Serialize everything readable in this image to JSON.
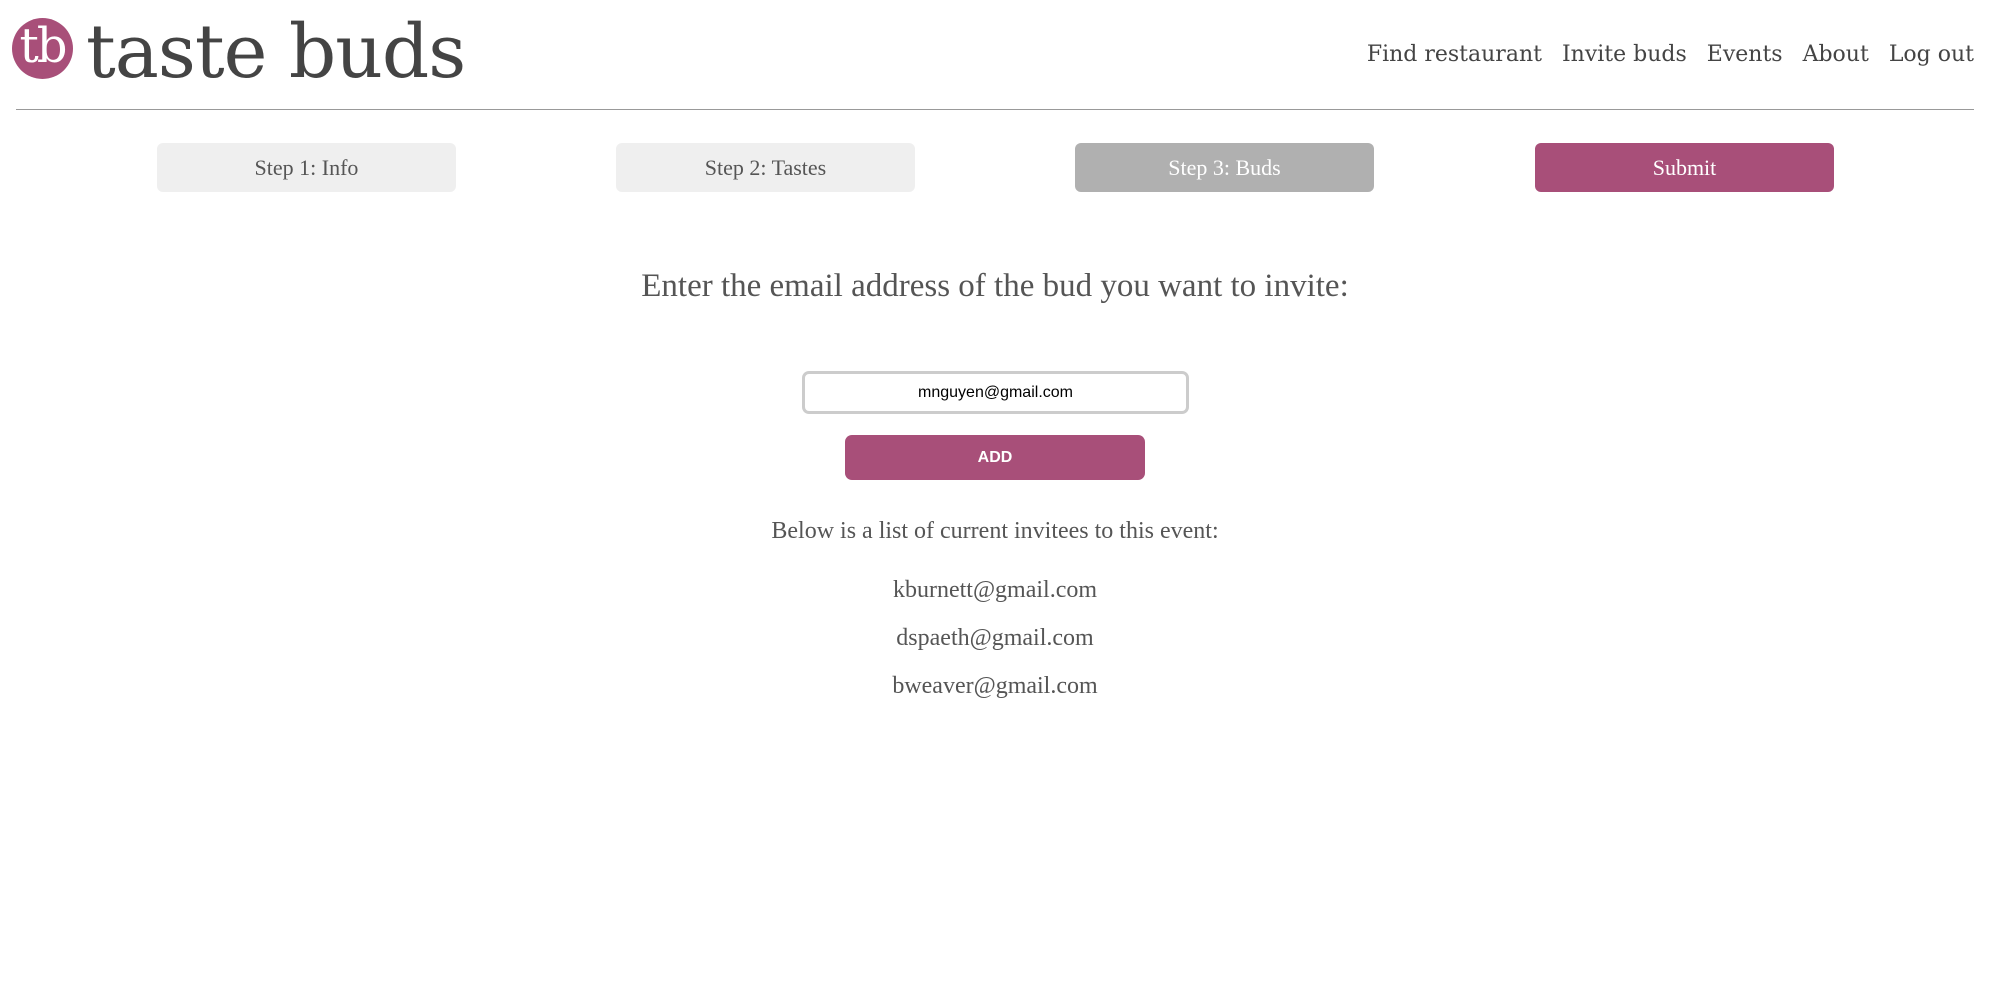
{
  "app": {
    "logo_initials": "tb",
    "logo_text": "taste buds",
    "brand_color": "#a84f79"
  },
  "nav": {
    "items": [
      {
        "label": "Find restaurant"
      },
      {
        "label": "Invite buds"
      },
      {
        "label": "Events"
      },
      {
        "label": "About"
      },
      {
        "label": "Log out"
      }
    ]
  },
  "steps": {
    "items": [
      {
        "label": "Step 1: Info",
        "state": "inactive"
      },
      {
        "label": "Step 2: Tastes",
        "state": "inactive"
      },
      {
        "label": "Step 3: Buds",
        "state": "current"
      },
      {
        "label": "Submit",
        "state": "submit"
      }
    ]
  },
  "invite": {
    "prompt": "Enter the email address of the bud you want to invite:",
    "email_value": "mnguyen@gmail.com",
    "add_label": "ADD",
    "list_heading": "Below is a list of current invitees to this event:",
    "invitees": [
      "kburnett@gmail.com",
      "dspaeth@gmail.com",
      "bweaver@gmail.com"
    ]
  }
}
